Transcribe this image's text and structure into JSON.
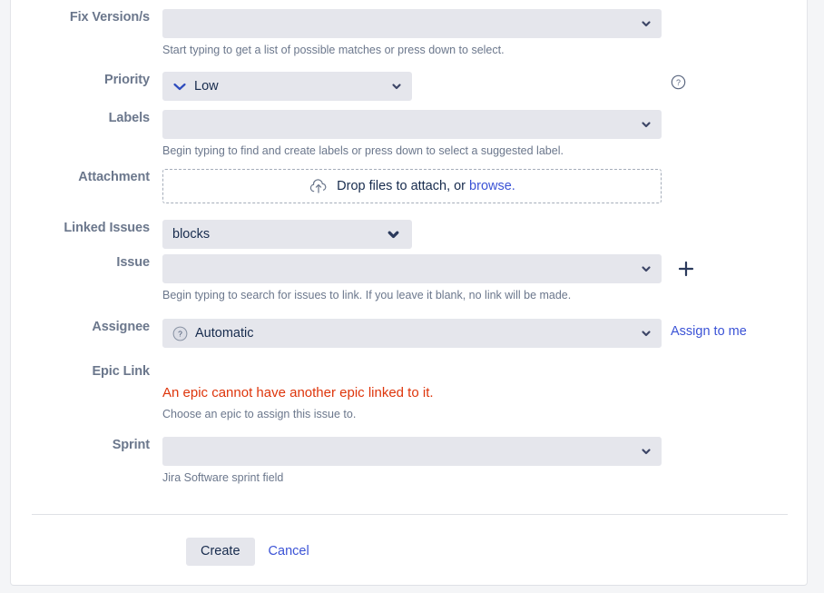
{
  "theme": {
    "page_background": "#f4f5f7",
    "dialog_background": "#ffffff",
    "field_background": "#e5e6ec",
    "label_color": "#6b778c",
    "text_color": "#172b4d",
    "link_color": "#3b53d6",
    "error_color": "#de350b",
    "priority_low_color": "#2e4bbd"
  },
  "form": {
    "fix_versions": {
      "label": "Fix Version/s",
      "value": "",
      "hint": "Start typing to get a list of possible matches or press down to select."
    },
    "priority": {
      "label": "Priority",
      "value": "Low",
      "icon": "priority-low-icon",
      "help_icon": "help-circle-icon"
    },
    "labels": {
      "label": "Labels",
      "value": "",
      "hint": "Begin typing to find and create labels or press down to select a suggested label."
    },
    "attachment": {
      "label": "Attachment",
      "icon": "upload-cloud-icon",
      "drop_text": "Drop files to attach, or",
      "browse_text": "browse."
    },
    "linked_issues": {
      "label": "Linked Issues",
      "value": "blocks"
    },
    "issue": {
      "label": "Issue",
      "value": "",
      "hint": "Begin typing to search for issues to link. If you leave it blank, no link will be made.",
      "add_icon": "plus-icon"
    },
    "assignee": {
      "label": "Assignee",
      "value": "Automatic",
      "avatar_icon": "avatar-question-icon",
      "assign_to_me": "Assign to me"
    },
    "epic_link": {
      "label": "Epic Link",
      "error": "An epic cannot have another epic linked to it.",
      "hint": "Choose an epic to assign this issue to."
    },
    "sprint": {
      "label": "Sprint",
      "value": "",
      "hint": "Jira Software sprint field"
    }
  },
  "footer": {
    "create_label": "Create",
    "cancel_label": "Cancel"
  }
}
